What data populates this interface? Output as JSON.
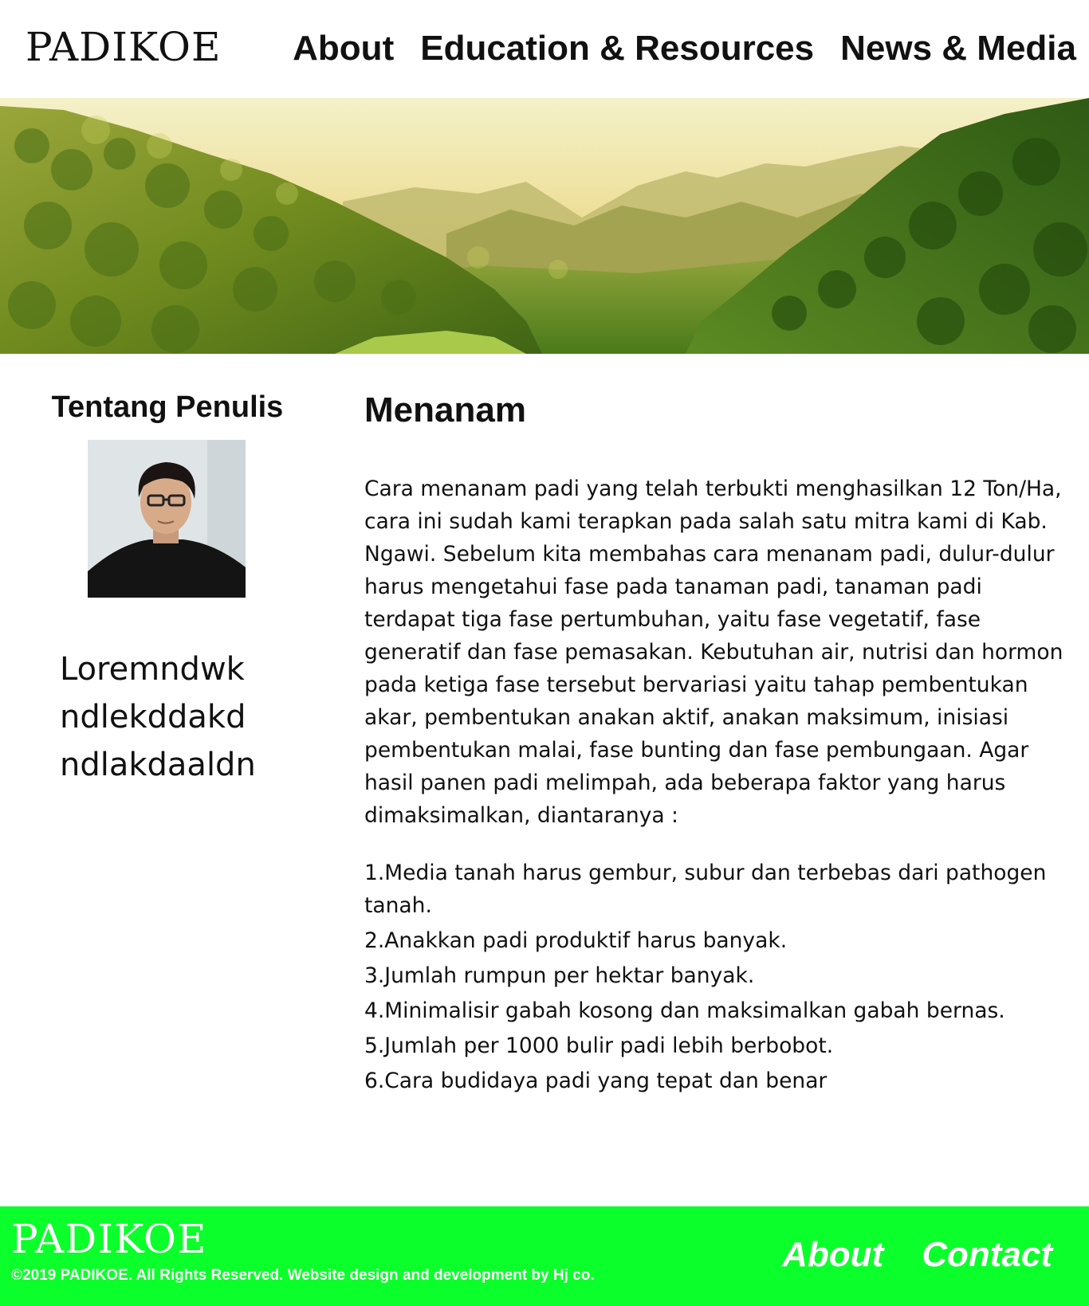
{
  "header": {
    "logo": "PADIKOE",
    "nav": [
      {
        "label": "About"
      },
      {
        "label": "Education & Resources"
      },
      {
        "label": "News & Media"
      }
    ]
  },
  "sidebar": {
    "title": "Tentang Penulis",
    "bio": "Loremndwk\nndlekddakd\nndlakdaaldn"
  },
  "article": {
    "title": "Menanam",
    "body": "Cara menanam padi yang telah terbukti menghasilkan 12 Ton/Ha, cara ini sudah kami terapkan pada salah satu mitra kami di Kab. Ngawi. Sebelum kita membahas cara menanam padi, dulur-dulur harus mengetahui fase pada tanaman padi, tanaman padi terdapat tiga fase pertumbuhan, yaitu fase vegetatif, fase generatif dan fase pemasakan. Kebutuhan air, nutrisi dan hormon pada ketiga fase tersebut bervariasi yaitu tahap pembentukan akar, pembentukan anakan aktif, anakan maksimum, inisiasi pembentukan malai, fase bunting dan fase pembungaan. Agar hasil panen padi melimpah, ada beberapa faktor yang harus dimaksimalkan, diantaranya :",
    "list": [
      "1.Media tanah harus gembur, subur dan terbebas dari pathogen tanah.",
      "2.Anakkan padi produktif harus banyak.",
      "3.Jumlah rumpun per hektar banyak.",
      "4.Minimalisir gabah kosong dan maksimalkan gabah bernas.",
      "5.Jumlah per 1000 bulir padi lebih berbobot.",
      "6.Cara budidaya padi yang tepat dan benar"
    ]
  },
  "footer": {
    "logo": "PADIKOE",
    "copyright": "©2019 PADIKOE. All Rights Reserved. Website design and development by Hj co.",
    "nav": [
      {
        "label": "About"
      },
      {
        "label": "Contact"
      }
    ],
    "background_color": "#0bff2a"
  }
}
